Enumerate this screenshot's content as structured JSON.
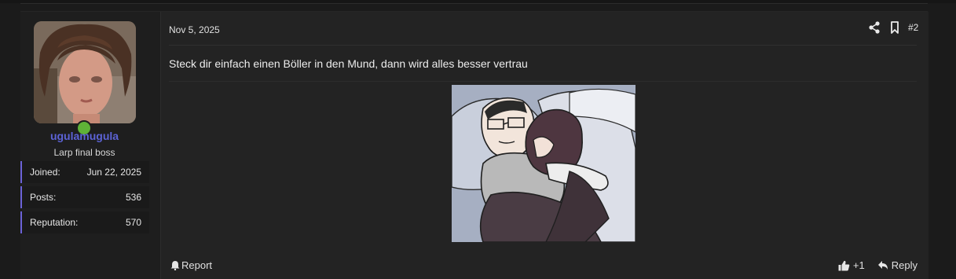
{
  "post": {
    "user": {
      "username": "ugulamugula",
      "title": "Larp final boss",
      "online": true,
      "stats": [
        {
          "label": "Joined:",
          "value": "Jun 22, 2025"
        },
        {
          "label": "Posts:",
          "value": "536"
        },
        {
          "label": "Reputation:",
          "value": "570"
        }
      ]
    },
    "date": "Nov 5, 2025",
    "post_number": "#2",
    "message": "Steck dir einfach einen Böller in den Mund, dann wird alles besser vertrau",
    "footer": {
      "report_label": "Report",
      "reaction_count": "+1",
      "reply_label": "Reply"
    }
  },
  "colors": {
    "username": "#5c63d6",
    "online": "#5fb237",
    "stat_accent": "#6c63d8",
    "background": "#1b1b1b",
    "panel": "#232323"
  },
  "icons": [
    "share-icon",
    "bookmark-icon",
    "bell-icon",
    "thumbs-up-icon",
    "reply-icon"
  ]
}
